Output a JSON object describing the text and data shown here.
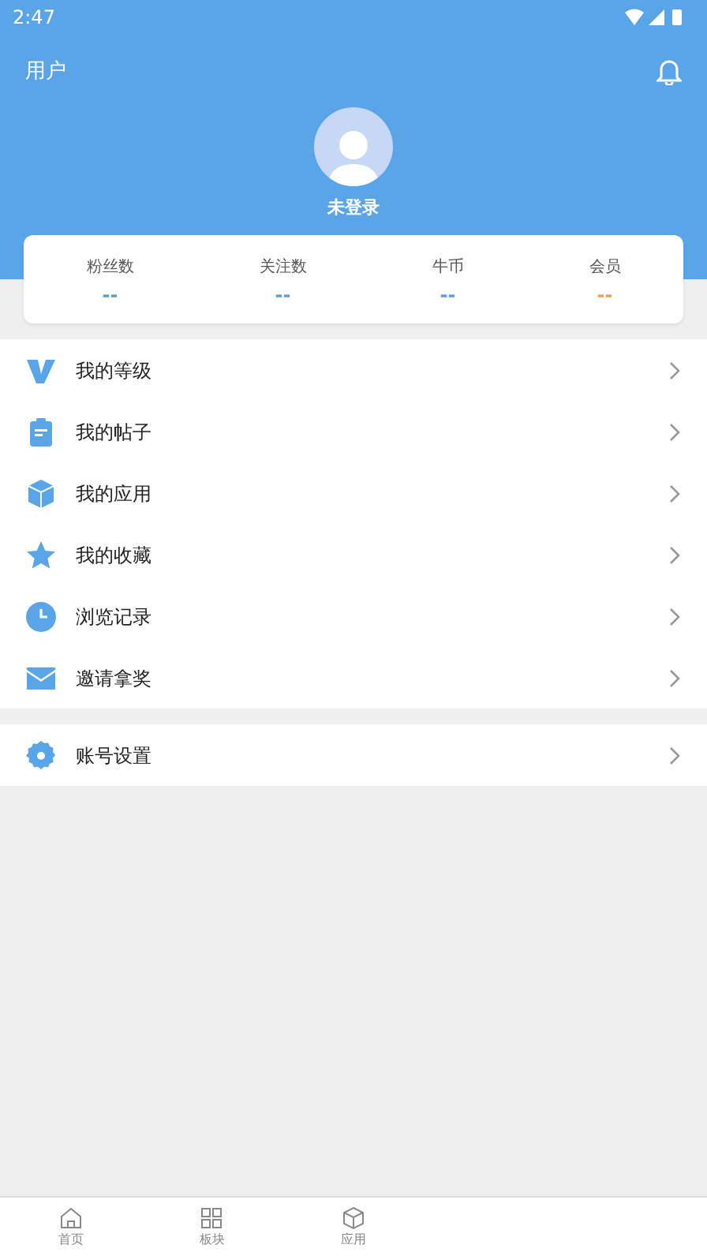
{
  "status_bar": {
    "time": "2:47"
  },
  "header": {
    "title": "用户",
    "user_name": "未登录"
  },
  "stats": [
    {
      "label": "粉丝数",
      "value": "--",
      "color": "#5a9fd8"
    },
    {
      "label": "关注数",
      "value": "--",
      "color": "#5a9fd8"
    },
    {
      "label": "牛币",
      "value": "--",
      "color": "#5a9fd8"
    },
    {
      "label": "会员",
      "value": "--",
      "color": "#f0a050"
    }
  ],
  "menu": [
    {
      "label": "我的等级"
    },
    {
      "label": "我的帖子"
    },
    {
      "label": "我的应用"
    },
    {
      "label": "我的收藏"
    },
    {
      "label": "浏览记录"
    },
    {
      "label": "邀请拿奖"
    }
  ],
  "settings_menu": [
    {
      "label": "账号设置"
    }
  ],
  "bottom_nav": [
    {
      "label": "首页"
    },
    {
      "label": "板块"
    },
    {
      "label": "应用"
    }
  ]
}
